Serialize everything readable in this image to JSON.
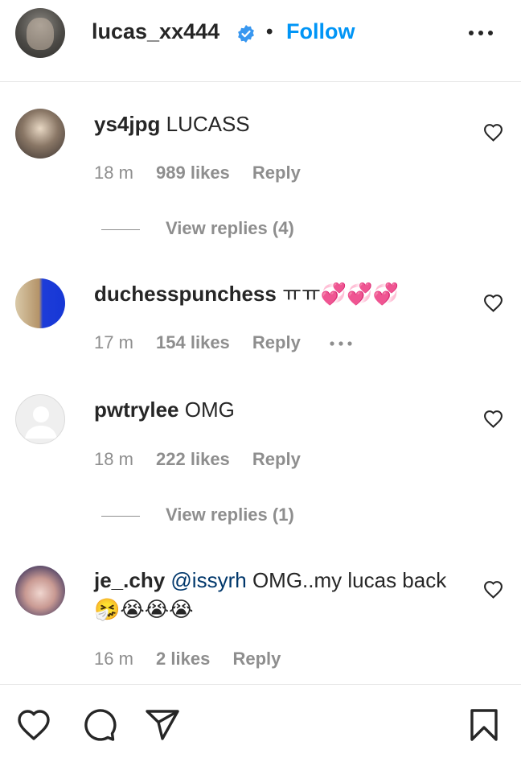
{
  "header": {
    "username": "lucas_xx444",
    "separator": "•",
    "follow_label": "Follow",
    "verified_icon": "verified-badge-icon",
    "more_icon": "more-horizontal-icon",
    "accent": "#0095f6"
  },
  "comments": [
    {
      "username": "ys4jpg",
      "text": "LUCASS",
      "time": "18 m",
      "likes": "989 likes",
      "reply_label": "Reply",
      "view_replies": "View replies (4)"
    },
    {
      "username": "duchesspunchess",
      "text": "ㅠㅠ💞💞💞",
      "time": "17 m",
      "likes": "154 likes",
      "reply_label": "Reply"
    },
    {
      "username": "pwtrylee",
      "text": "OMG",
      "time": "18 m",
      "likes": "222 likes",
      "reply_label": "Reply",
      "view_replies": "View replies (1)"
    },
    {
      "username": "je_.chy",
      "mention": "@issyrh",
      "text": "OMG..my lucas back🤧😭😭😭",
      "time": "16 m",
      "likes": "2 likes",
      "reply_label": "Reply"
    }
  ],
  "footer": {
    "icons": [
      "heart-icon",
      "comment-icon",
      "share-icon",
      "bookmark-icon"
    ]
  }
}
